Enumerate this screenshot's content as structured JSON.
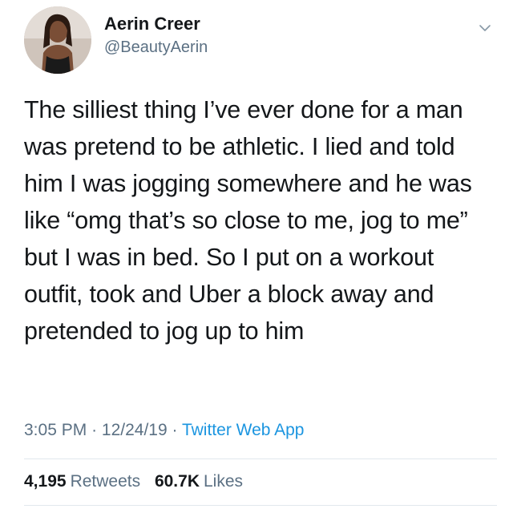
{
  "tweet": {
    "author": {
      "display_name": "Aerin Creer",
      "handle": "@BeautyAerin"
    },
    "text": "The silliest thing I’ve ever done for a man was pretend to be athletic. I lied and told him I was jogging somewhere and he was like “omg that’s so close to me, jog to me” but I was in bed. So I put on a workout outfit, took and Uber a block away and pretended to jog up to him",
    "time": "3:05 PM",
    "date": "12/24/19",
    "separator": "·",
    "source": "Twitter Web App",
    "retweets": {
      "count": "4,195",
      "label": "Retweets"
    },
    "likes": {
      "count": "60.7K",
      "label": "Likes"
    }
  },
  "colors": {
    "text": "#14171a",
    "secondary": "#5b7083",
    "link": "#1b95e0",
    "divider": "#e1e8ed"
  },
  "icons": {
    "menu": "chevron-down-icon"
  }
}
